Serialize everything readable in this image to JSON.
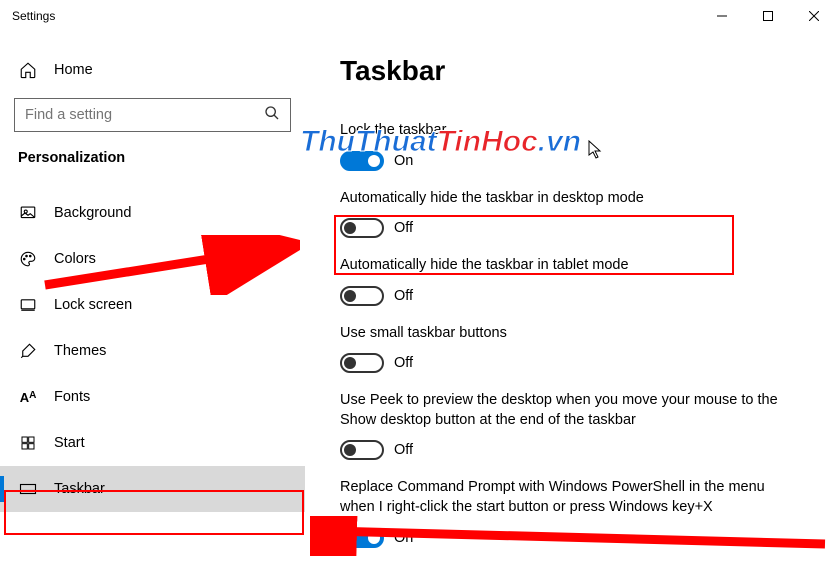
{
  "window": {
    "title": "Settings"
  },
  "home": {
    "label": "Home"
  },
  "search": {
    "placeholder": "Find a setting"
  },
  "section": {
    "header": "Personalization"
  },
  "nav": {
    "items": [
      {
        "label": "Background"
      },
      {
        "label": "Colors"
      },
      {
        "label": "Lock screen"
      },
      {
        "label": "Themes"
      },
      {
        "label": "Fonts"
      },
      {
        "label": "Start"
      },
      {
        "label": "Taskbar"
      }
    ]
  },
  "page": {
    "title": "Taskbar"
  },
  "settings": [
    {
      "label": "Lock the taskbar",
      "state": "On",
      "on": true
    },
    {
      "label": "Automatically hide the taskbar in desktop mode",
      "state": "Off",
      "on": false
    },
    {
      "label": "Automatically hide the taskbar in tablet mode",
      "state": "Off",
      "on": false
    },
    {
      "label": "Use small taskbar buttons",
      "state": "Off",
      "on": false
    },
    {
      "label": "Use Peek to preview the desktop when you move your mouse to the Show desktop button at the end of the taskbar",
      "state": "Off",
      "on": false
    },
    {
      "label": "Replace Command Prompt with Windows PowerShell in the menu when I right-click the start button or press Windows key+X",
      "state": "On",
      "on": true
    }
  ],
  "watermark": {
    "part1": "ThuThuat",
    "part2": "TinHoc",
    "part3": ".vn"
  }
}
